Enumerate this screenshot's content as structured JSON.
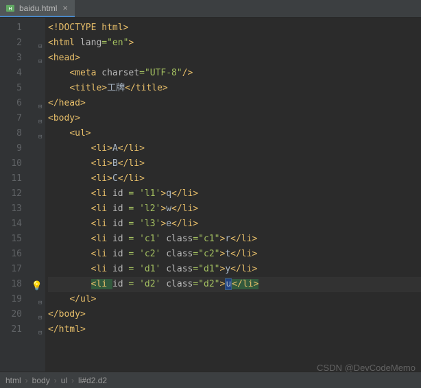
{
  "tab": {
    "filename": "baidu.html"
  },
  "gutter": {
    "lines": [
      "1",
      "2",
      "3",
      "4",
      "5",
      "6",
      "7",
      "8",
      "9",
      "10",
      "11",
      "12",
      "13",
      "14",
      "15",
      "16",
      "17",
      "18",
      "19",
      "20",
      "21"
    ],
    "bulb_line": 18
  },
  "code": {
    "l1": {
      "lt": "<",
      "doctype": "!DOCTYPE ",
      "html": "html",
      "gt": ">"
    },
    "l2": {
      "lt": "<",
      "tag": "html ",
      "attr": "lang",
      "eq": "=",
      "val": "\"en\"",
      "gt": ">"
    },
    "l3": {
      "lt": "<",
      "tag": "head",
      "gt": ">"
    },
    "l4": {
      "lt": "<",
      "tag": "meta ",
      "attr": "charset",
      "eq": "=",
      "val": "\"UTF-8\"",
      "close": "/>"
    },
    "l5": {
      "lt": "<",
      "tag": "title",
      "gt": ">",
      "txt": "工牌",
      "lt2": "</",
      "tag2": "title",
      "gt2": ">"
    },
    "l6": {
      "lt": "</",
      "tag": "head",
      "gt": ">"
    },
    "l7": {
      "lt": "<",
      "tag": "body",
      "gt": ">"
    },
    "l8": {
      "lt": "<",
      "tag": "ul",
      "gt": ">"
    },
    "l9": {
      "lt": "<",
      "tag": "li",
      "gt": ">",
      "txt": "A",
      "lt2": "</",
      "tag2": "li",
      "gt2": ">"
    },
    "l10": {
      "lt": "<",
      "tag": "li",
      "gt": ">",
      "txt": "B",
      "lt2": "</",
      "tag2": "li",
      "gt2": ">"
    },
    "l11": {
      "lt": "<",
      "tag": "li",
      "gt": ">",
      "txt": "C",
      "lt2": "</",
      "tag2": "li",
      "gt2": ">"
    },
    "l12": {
      "lt": "<",
      "tag": "li ",
      "attr": "id ",
      "eq": "= ",
      "val": "'l1'",
      "gt": ">",
      "txt": "q",
      "lt2": "</",
      "tag2": "li",
      "gt2": ">"
    },
    "l13": {
      "lt": "<",
      "tag": "li ",
      "attr": "id ",
      "eq": "= ",
      "val": "'l2'",
      "gt": ">",
      "txt": "w",
      "lt2": "</",
      "tag2": "li",
      "gt2": ">"
    },
    "l14": {
      "lt": "<",
      "tag": "li ",
      "attr": "id ",
      "eq": "= ",
      "val": "'l3'",
      "gt": ">",
      "txt": "e",
      "lt2": "</",
      "tag2": "li",
      "gt2": ">"
    },
    "l15": {
      "lt": "<",
      "tag": "li ",
      "attr": "id ",
      "eq": "= ",
      "val": "'c1' ",
      "attr2": "class",
      "eq2": "=",
      "val2": "\"c1\"",
      "gt": ">",
      "txt": "r",
      "lt2": "</",
      "tag2": "li",
      "gt2": ">"
    },
    "l16": {
      "lt": "<",
      "tag": "li ",
      "attr": "id ",
      "eq": "= ",
      "val": "'c2' ",
      "attr2": "class",
      "eq2": "=",
      "val2": "\"c2\"",
      "gt": ">",
      "txt": "t",
      "lt2": "</",
      "tag2": "li",
      "gt2": ">"
    },
    "l17": {
      "lt": "<",
      "tag": "li ",
      "attr": "id ",
      "eq": "= ",
      "val": "'d1' ",
      "attr2": "class",
      "eq2": "=",
      "val2": "\"d1\"",
      "gt": ">",
      "txt": "y",
      "lt2": "</",
      "tag2": "li",
      "gt2": ">"
    },
    "l18": {
      "lt": "<",
      "tag": "li ",
      "attr": "id ",
      "eq": "= ",
      "val": "'d2' ",
      "attr2": "class",
      "eq2": "=",
      "val2": "\"d2\"",
      "gt": ">",
      "txt": "u",
      "lt2": "</",
      "tag2": "li",
      "gt2": ">"
    },
    "l19": {
      "lt": "</",
      "tag": "ul",
      "gt": ">"
    },
    "l20": {
      "lt": "</",
      "tag": "body",
      "gt": ">"
    },
    "l21": {
      "lt": "</",
      "tag": "html",
      "gt": ">"
    }
  },
  "breadcrumb": {
    "c1": "html",
    "c2": "body",
    "c3": "ul",
    "c4": "li#d2.d2"
  },
  "watermark": "CSDN @DevCodeMemo"
}
